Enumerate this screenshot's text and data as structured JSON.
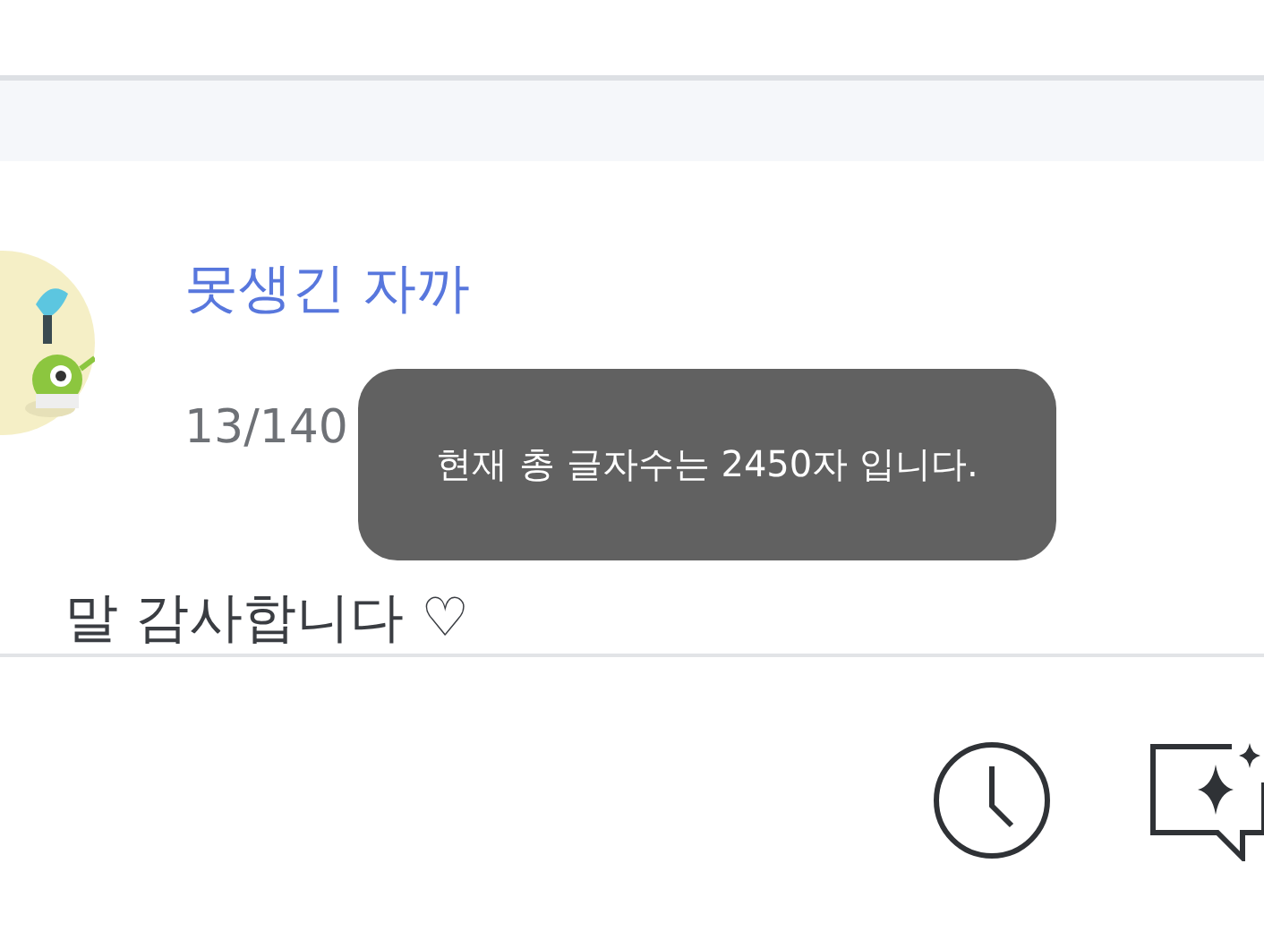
{
  "comment": {
    "author": "못생긴 자까",
    "counter": "13/140",
    "text": "말 감사합니다 ♡"
  },
  "toast": {
    "message": "현재 총 글자수는 2450자 입니다."
  }
}
